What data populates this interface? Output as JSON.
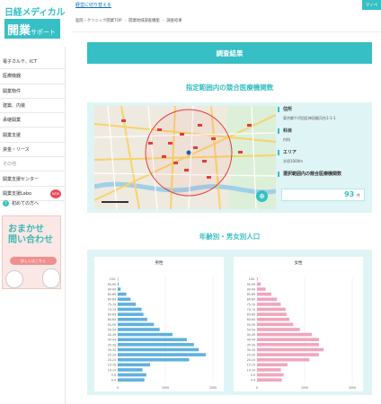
{
  "brand": {
    "line1": "日経メディカル",
    "line2": "開業",
    "line2_small": "サポート"
  },
  "sidebar": {
    "items": [
      {
        "label": "電子カルテ、ICT",
        "new": false,
        "dim": false
      },
      {
        "label": "医療機器",
        "new": false,
        "dim": false
      },
      {
        "label": "開業物件",
        "new": false,
        "dim": false
      },
      {
        "label": "建築、内装",
        "new": false,
        "dim": false
      },
      {
        "label": "承継開業",
        "new": false,
        "dim": false
      },
      {
        "label": "開業支援",
        "new": false,
        "dim": false
      },
      {
        "label": "資金・リース",
        "new": false,
        "dim": false
      },
      {
        "label": "その他",
        "new": false,
        "dim": true
      },
      {
        "label": "開業支援センター",
        "new": false,
        "dim": false
      },
      {
        "label": "開業支援Labo",
        "new": true,
        "dim": false
      }
    ],
    "new_badge": "NEW",
    "first_time": "初めての方へ",
    "first_time_icon": "question-circle-icon",
    "banner": {
      "line1": "おまかせ",
      "line2": "問い合わせ",
      "button": "詳しくはこちら"
    }
  },
  "topbar": {
    "switch_label": "経営に切り替える",
    "mypage": "マイペ"
  },
  "breadcrumb": [
    "医院・クリニック開業TOP",
    "開業地域調査機能",
    "調査結果"
  ],
  "result_title": "調査結果",
  "section1_title": "指定範囲内の競合医療機関数",
  "info": {
    "address_label": "住所",
    "address_value": "東京都千代田区神田駿河台1-1-1",
    "department_label": "科目",
    "department_value": "内科",
    "area_label": "エリア",
    "area_value": "半径1000m",
    "count_label": "選択範囲内の競合医療機関数",
    "count_value": "93",
    "count_unit": "件"
  },
  "map": {
    "zoom_icon": "zoom-in-icon"
  },
  "section2_title": "年齢別・男女別人口",
  "chart_data": [
    {
      "type": "bar",
      "title": "男性",
      "color": "#5fb1df",
      "categories": [
        "100-",
        "95-99",
        "90-94",
        "85-89",
        "80-84",
        "75-79",
        "70-74",
        "65-69",
        "60-64",
        "55-59",
        "50-54",
        "45-49",
        "40-44",
        "35-39",
        "30-34",
        "25-29",
        "20-24",
        "15-19",
        "10-14",
        "5-9",
        "0-4"
      ],
      "values": [
        5,
        20,
        60,
        180,
        270,
        380,
        500,
        540,
        620,
        760,
        880,
        1150,
        1450,
        1600,
        1700,
        1850,
        1500,
        680,
        520,
        600,
        560
      ],
      "xticks": [
        "0",
        "1000",
        "2000"
      ],
      "xlim": [
        0,
        2000
      ]
    },
    {
      "type": "bar",
      "title": "女性",
      "color": "#f0a6bd",
      "categories": [
        "100-",
        "95-99",
        "90-94",
        "85-89",
        "80-84",
        "75-79",
        "70-74",
        "65-69",
        "60-64",
        "55-59",
        "50-54",
        "45-49",
        "40-44",
        "35-39",
        "30-34",
        "25-29",
        "20-24",
        "15-19",
        "10-14",
        "5-9",
        "0-4"
      ],
      "values": [
        20,
        80,
        180,
        300,
        420,
        500,
        600,
        620,
        680,
        760,
        900,
        1150,
        1300,
        1300,
        1400,
        1300,
        1100,
        640,
        500,
        560,
        520
      ],
      "xticks": [
        "0",
        "1000",
        "2000"
      ],
      "xlim": [
        0,
        2000
      ]
    }
  ]
}
